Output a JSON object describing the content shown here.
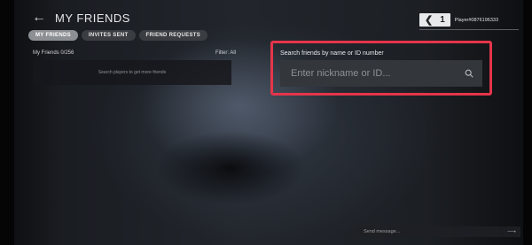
{
  "header": {
    "title": "MY FRIENDS"
  },
  "tabs": [
    {
      "label": "MY FRIENDS",
      "active": true
    },
    {
      "label": "INVITES SENT",
      "active": false
    },
    {
      "label": "FRIEND REQUESTS",
      "active": false
    }
  ],
  "friends": {
    "count_label": "My Friends 0/256",
    "filter_label": "Filter: All",
    "empty_text": "Search players to get more friends"
  },
  "player": {
    "level": "1",
    "id": "Player#0876196333"
  },
  "search": {
    "label": "Search friends by name or ID number",
    "placeholder": "Enter nickname or ID..."
  },
  "message": {
    "placeholder": "Send message..."
  },
  "icons": {
    "back": "back-arrow-icon",
    "search": "search-icon",
    "chevron": "chevron-left-icon",
    "send": "send-arrow-icon"
  },
  "colors": {
    "highlight": "#e5354a",
    "active_tab": "#8c8f94",
    "tab": "#3a3d42"
  }
}
